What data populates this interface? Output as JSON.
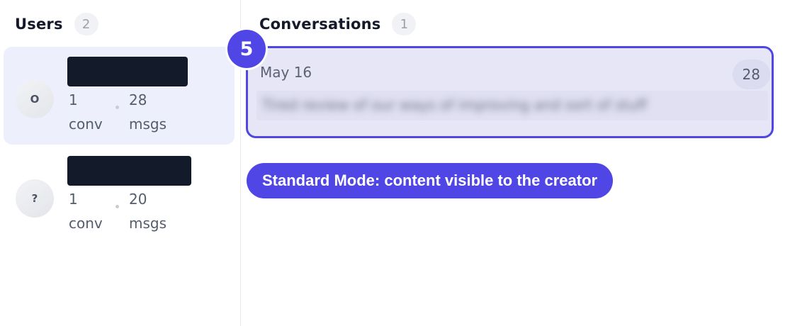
{
  "users": {
    "title": "Users",
    "count": "2",
    "items": [
      {
        "avatar": "O",
        "conv_num": "1",
        "conv_unit": "conv",
        "msg_num": "28",
        "msg_unit": "msgs",
        "selected": true
      },
      {
        "avatar": "?",
        "conv_num": "1",
        "conv_unit": "conv",
        "msg_num": "20",
        "msg_unit": "msgs",
        "selected": false
      }
    ]
  },
  "conversations": {
    "title": "Conversations",
    "count": "1",
    "items": [
      {
        "date": "May 16",
        "message_count": "28",
        "preview": "Tired review of our ways of improving and sort of stuff"
      }
    ]
  },
  "tour": {
    "step": "5",
    "mode_label": "Standard Mode: content visible to the creator"
  },
  "colors": {
    "accent": "#4f46e5",
    "selected_bg": "#edf0fc",
    "redaction": "#131a2a"
  }
}
